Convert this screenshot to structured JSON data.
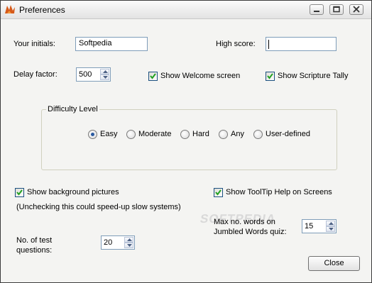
{
  "window": {
    "title": "Preferences"
  },
  "fields": {
    "initials_label": "Your initials:",
    "initials_value": "Softpedia",
    "high_score_label": "High score:",
    "high_score_value": "",
    "delay_label": "Delay factor:",
    "delay_value": "500"
  },
  "checkboxes": {
    "welcome": {
      "label": "Show Welcome screen",
      "checked": true
    },
    "scripture": {
      "label": "Show Scripture Tally",
      "checked": true
    },
    "background": {
      "label": "Show background pictures",
      "checked": true
    },
    "tooltip": {
      "label": "Show ToolTip Help on Screens",
      "checked": true
    }
  },
  "difficulty": {
    "title": "Difficulty Level",
    "options": [
      "Easy",
      "Moderate",
      "Hard",
      "Any",
      "User-defined"
    ],
    "selected": "Easy"
  },
  "note": "(Unchecking this could speed-up slow systems)",
  "questions": {
    "label_line1": "No. of test",
    "label_line2": "questions:",
    "value": "20"
  },
  "max_words": {
    "label_line1": "Max no. words on",
    "label_line2": "Jumbled Words quiz:",
    "value": "15"
  },
  "buttons": {
    "close": "Close"
  },
  "watermark": "SOFTPEDIA"
}
